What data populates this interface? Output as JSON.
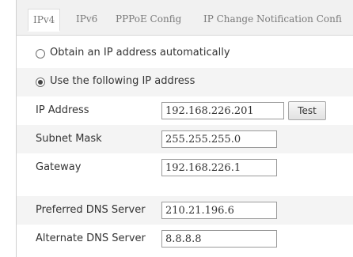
{
  "tabs": [
    {
      "label": "IPv4",
      "active": true
    },
    {
      "label": "IPv6",
      "active": false
    },
    {
      "label": "PPPoE Config",
      "active": false
    },
    {
      "label": "IP Change Notification Confi",
      "active": false
    }
  ],
  "ip_mode": {
    "auto_label": "Obtain an IP address automatically",
    "auto_selected": false,
    "manual_label": "Use the following IP address",
    "manual_selected": true
  },
  "fields": {
    "ip_address": {
      "label": "IP Address",
      "value": "192.168.226.201"
    },
    "subnet_mask": {
      "label": "Subnet Mask",
      "value": "255.255.255.0"
    },
    "gateway": {
      "label": "Gateway",
      "value": "192.168.226.1"
    },
    "preferred_dns": {
      "label": "Preferred DNS Server",
      "value": "210.21.196.6"
    },
    "alternate_dns": {
      "label": "Alternate DNS Server",
      "value": "8.8.8.8"
    }
  },
  "buttons": {
    "test_label": "Test"
  }
}
